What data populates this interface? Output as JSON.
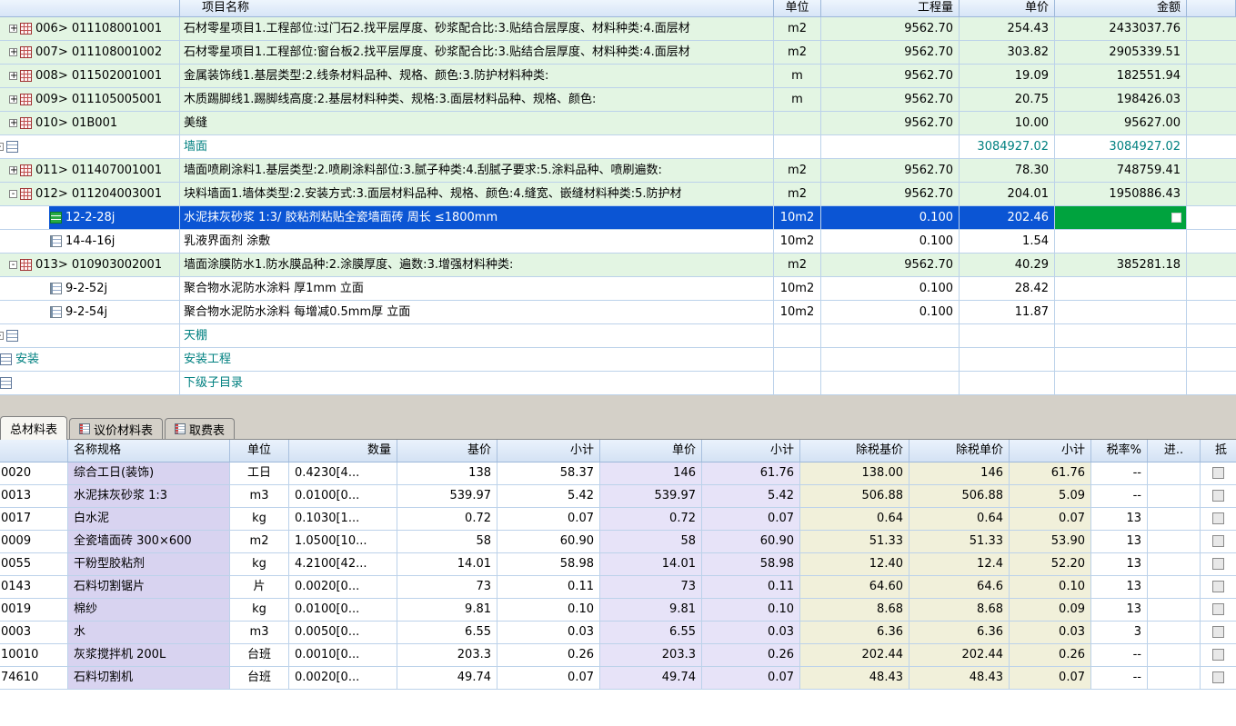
{
  "colors": {
    "selected_row_blue": "#0b55d4",
    "selected_amount_green": "#00a33e",
    "category_teal": "#008080",
    "bill_row_green": "#e3f5e3",
    "name_column_lavender": "#d8d3f0",
    "price_column_lavender": "#e7e3f8",
    "extax_column_yellow": "#f1f0da"
  },
  "top_table": {
    "headers": {
      "name": "项目名称",
      "unit": "单位",
      "quantity": "工程量",
      "unit_price": "单价",
      "amount": "金额"
    },
    "rows": [
      {
        "code": "006> 011108001001",
        "name": "石材零星项目1.工程部位:过门石2.找平层厚度、砂浆配合比:3.贴结合层厚度、材料种类:4.面层材",
        "unit": "m2",
        "qty": "9562.70",
        "price": "254.43",
        "amount": "2433037.76",
        "level": 1,
        "exp": "plus",
        "icon": "list",
        "bg": "green"
      },
      {
        "code": "007> 011108001002",
        "name": "石材零星项目1.工程部位:窗台板2.找平层厚度、砂浆配合比:3.贴结合层厚度、材料种类:4.面层材",
        "unit": "m2",
        "qty": "9562.70",
        "price": "303.82",
        "amount": "2905339.51",
        "level": 1,
        "exp": "plus",
        "icon": "list",
        "bg": "green"
      },
      {
        "code": "008> 011502001001",
        "name": "金属装饰线1.基层类型:2.线条材料品种、规格、颜色:3.防护材料种类:",
        "unit": "m",
        "qty": "9562.70",
        "price": "19.09",
        "amount": "182551.94",
        "level": 1,
        "exp": "plus",
        "icon": "list",
        "bg": "green"
      },
      {
        "code": "009> 011105005001",
        "name": "木质踢脚线1.踢脚线高度:2.基层材料种类、规格:3.面层材料品种、规格、颜色:",
        "unit": "m",
        "qty": "9562.70",
        "price": "20.75",
        "amount": "198426.03",
        "level": 1,
        "exp": "plus",
        "icon": "list",
        "bg": "green"
      },
      {
        "code": "010> 01B001",
        "name": "美缝",
        "unit": "",
        "qty": "9562.70",
        "price": "10.00",
        "amount": "95627.00",
        "level": 1,
        "exp": "plus",
        "icon": "list",
        "bg": "green"
      },
      {
        "code": "",
        "name": "墙面",
        "unit": "",
        "qty": "",
        "price": "3084927.02",
        "amount": "3084927.02",
        "level": 0,
        "exp": "minus",
        "icon": "cat",
        "cat": true
      },
      {
        "code": "011> 011407001001",
        "name": "墙面喷刷涂料1.基层类型:2.喷刷涂料部位:3.腻子种类:4.刮腻子要求:5.涂料品种、喷刷遍数:",
        "unit": "m2",
        "qty": "9562.70",
        "price": "78.30",
        "amount": "748759.41",
        "level": 1,
        "exp": "plus",
        "icon": "list",
        "bg": "green"
      },
      {
        "code": "012> 011204003001",
        "name": "块料墙面1.墙体类型:2.安装方式:3.面层材料品种、规格、颜色:4.缝宽、嵌缝材料种类:5.防护材",
        "unit": "m2",
        "qty": "9562.70",
        "price": "204.01",
        "amount": "1950886.43",
        "level": 1,
        "exp": "minus",
        "icon": "list",
        "bg": "green"
      },
      {
        "code": "12-2-28j",
        "name": "水泥抹灰砂浆 1:3/ 胶粘剂粘贴全瓷墙面砖  周长 ≤1800mm",
        "unit": "10m2",
        "qty": "0.100",
        "price": "202.46",
        "amount": "",
        "level": 2,
        "icon": "quotag",
        "selected": true,
        "amount_green": true
      },
      {
        "code": "14-4-16j",
        "name": "乳液界面剂 涂敷",
        "unit": "10m2",
        "qty": "0.100",
        "price": "1.54",
        "amount": "",
        "level": 2,
        "icon": "quota"
      },
      {
        "code": "013> 010903002001",
        "name": "墙面涂膜防水1.防水膜品种:2.涂膜厚度、遍数:3.增强材料种类:",
        "unit": "m2",
        "qty": "9562.70",
        "price": "40.29",
        "amount": "385281.18",
        "level": 1,
        "exp": "minus",
        "icon": "list",
        "bg": "green"
      },
      {
        "code": "9-2-52j",
        "name": "聚合物水泥防水涂料 厚1mm 立面",
        "unit": "10m2",
        "qty": "0.100",
        "price": "28.42",
        "amount": "",
        "level": 2,
        "icon": "quota"
      },
      {
        "code": "9-2-54j",
        "name": "聚合物水泥防水涂料 每增减0.5mm厚 立面",
        "unit": "10m2",
        "qty": "0.100",
        "price": "11.87",
        "amount": "",
        "level": 2,
        "icon": "quota"
      },
      {
        "code": "",
        "name": "天棚",
        "unit": "",
        "qty": "",
        "price": "",
        "amount": "",
        "level": 0,
        "exp": "minus",
        "icon": "cat",
        "cat": true
      },
      {
        "code": "安装",
        "name": "安装工程",
        "unit": "",
        "qty": "",
        "price": "",
        "amount": "",
        "level": 0,
        "icon": "cat",
        "cat": true
      },
      {
        "code": "",
        "name": "下级子目录",
        "unit": "",
        "qty": "",
        "price": "",
        "amount": "",
        "level": 0,
        "icon": "cat",
        "cat": true
      }
    ]
  },
  "materials": {
    "tabs": [
      {
        "label": "总材料表",
        "name": "tab-total-materials",
        "active": true
      },
      {
        "label": "议价材料表",
        "name": "tab-negotiated-materials",
        "icon": true
      },
      {
        "label": "取费表",
        "name": "tab-fee-table",
        "icon": true
      }
    ],
    "headers": [
      "",
      "名称规格",
      "单位",
      "数量",
      "基价",
      "小计",
      "单价",
      "小计",
      "除税基价",
      "除税单价",
      "小计",
      "税率%",
      "进..",
      "抵"
    ],
    "rows": [
      [
        "0020",
        "综合工日(装饰)",
        "工日",
        "0.4230[4...",
        "138",
        "58.37",
        "146",
        "61.76",
        "138.00",
        "146",
        "61.76",
        "--",
        ""
      ],
      [
        "0013",
        "水泥抹灰砂浆 1:3",
        "m3",
        "0.0100[0...",
        "539.97",
        "5.42",
        "539.97",
        "5.42",
        "506.88",
        "506.88",
        "5.09",
        "--",
        ""
      ],
      [
        "0017",
        "白水泥",
        "kg",
        "0.1030[1...",
        "0.72",
        "0.07",
        "0.72",
        "0.07",
        "0.64",
        "0.64",
        "0.07",
        "13",
        ""
      ],
      [
        "0009",
        "全瓷墙面砖 300×600",
        "m2",
        "1.0500[10...",
        "58",
        "60.90",
        "58",
        "60.90",
        "51.33",
        "51.33",
        "53.90",
        "13",
        ""
      ],
      [
        "0055",
        "干粉型胶粘剂",
        "kg",
        "4.2100[42...",
        "14.01",
        "58.98",
        "14.01",
        "58.98",
        "12.40",
        "12.4",
        "52.20",
        "13",
        ""
      ],
      [
        "0143",
        "石料切割锯片",
        "片",
        "0.0020[0...",
        "73",
        "0.11",
        "73",
        "0.11",
        "64.60",
        "64.6",
        "0.10",
        "13",
        ""
      ],
      [
        "0019",
        "棉纱",
        "kg",
        "0.0100[0...",
        "9.81",
        "0.10",
        "9.81",
        "0.10",
        "8.68",
        "8.68",
        "0.09",
        "13",
        ""
      ],
      [
        "0003",
        "水",
        "m3",
        "0.0050[0...",
        "6.55",
        "0.03",
        "6.55",
        "0.03",
        "6.36",
        "6.36",
        "0.03",
        "3",
        ""
      ],
      [
        "10010",
        "灰浆搅拌机 200L",
        "台班",
        "0.0010[0...",
        "203.3",
        "0.26",
        "203.3",
        "0.26",
        "202.44",
        "202.44",
        "0.26",
        "--",
        ""
      ],
      [
        "74610",
        "石料切割机",
        "台班",
        "0.0020[0...",
        "49.74",
        "0.07",
        "49.74",
        "0.07",
        "48.43",
        "48.43",
        "0.07",
        "--",
        ""
      ]
    ]
  }
}
